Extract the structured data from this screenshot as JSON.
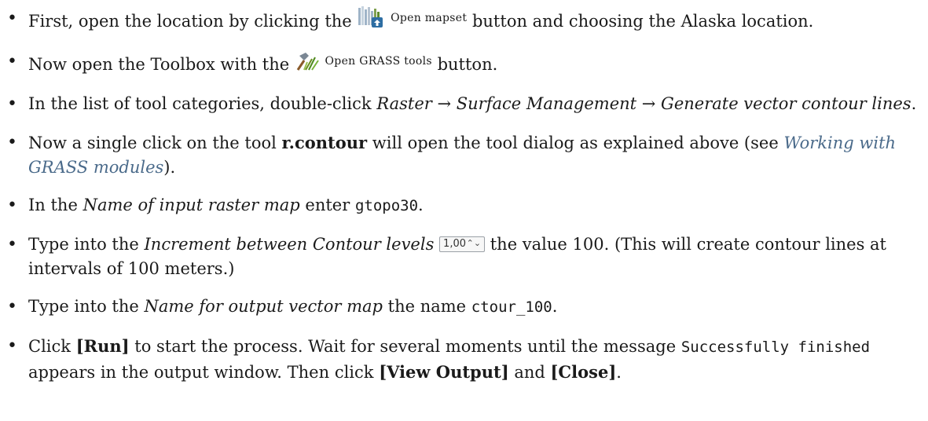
{
  "items": [
    {
      "t1": "First, open the location by clicking the",
      "button_label": "Open mapset",
      "t2": "button and choosing the Alaska location."
    },
    {
      "t1": "Now open the Toolbox with the",
      "button_label": "Open GRASS tools",
      "t2": "button."
    },
    {
      "t1": "In the list of tool categories, double-click",
      "path": "Raster → Surface Management → Generate vector contour lines",
      "t2": "."
    },
    {
      "t1": "Now a single click on the tool",
      "tool": "r.contour",
      "t2": "will open the tool dialog as explained above (see",
      "link": "Working with GRASS modules",
      "t3": ")."
    },
    {
      "t1": "In the",
      "field": "Name of input raster map",
      "t2": "enter",
      "code": "gtopo30",
      "t3": "."
    },
    {
      "t1": "Type into the",
      "field": "Increment between Contour levels",
      "spin_value": "1,00",
      "spin_arrows": "⌃⌄",
      "t2": "the value 100. (This will create contour lines at intervals of 100 meters.)"
    },
    {
      "t1": "Type into the",
      "field": "Name for output vector map",
      "t2": "the name",
      "code": "ctour_100",
      "t3": "."
    },
    {
      "t1": "Click",
      "run": "[Run]",
      "t2": "to start the process. Wait for several moments until the message",
      "code": "Successfully finished",
      "t3": "appears in the output window. Then click",
      "view": "[View Output]",
      "t4": "and",
      "close": "[Close]",
      "t5": "."
    }
  ]
}
